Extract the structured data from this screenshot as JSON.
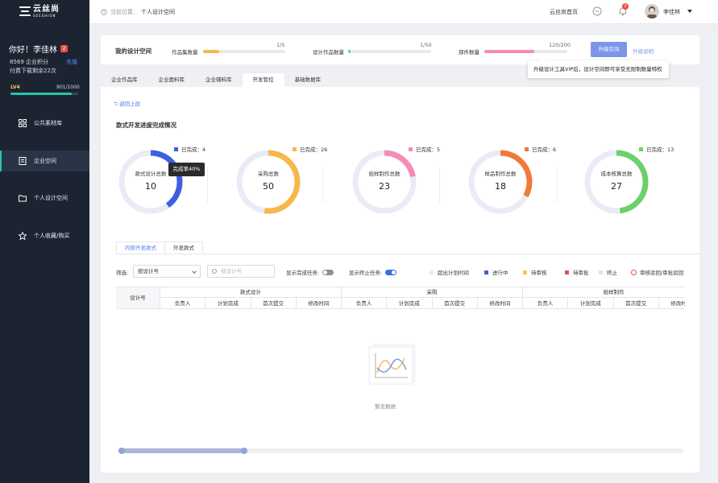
{
  "brand": {
    "name_cn": "云丝尚",
    "name_en": "SEESHION"
  },
  "sidebar": {
    "greeting": "你好！李佳林",
    "level_badge": "2",
    "points": "8569 企业积分",
    "recharge": "充值",
    "downloads_left": "付费下载剩余22次",
    "level": "LV4",
    "level_progress": "901/1000",
    "level_fraction": 0.9,
    "items": [
      {
        "label": "公共素材库",
        "icon": "grid-icon"
      },
      {
        "label": "企业空间",
        "icon": "doc-icon"
      },
      {
        "label": "个人设计空间",
        "icon": "folder-icon"
      },
      {
        "label": "个人收藏/购买",
        "icon": "star-icon"
      }
    ]
  },
  "topbar": {
    "crumb_prefix": "当前位置：",
    "crumb_current": "个人设计空间",
    "home_link": "云丝尚首页",
    "notify_count": "3",
    "user_name": "李佳林"
  },
  "quota": {
    "title": "我的设计空间",
    "items": [
      {
        "label": "作品集数量",
        "value": "1/5",
        "fraction": 0.2,
        "color": "#f7b84b"
      },
      {
        "label": "设计作品数量",
        "value": "1/50",
        "fraction": 0.02,
        "color": "#6cd06c"
      },
      {
        "label": "部件数量",
        "value": "120/200",
        "fraction": 0.6,
        "color": "#f48bb8"
      }
    ],
    "upgrade_button": "升级空间",
    "upgrade_info": "升级说明",
    "tooltip": "升级设计工具VIP后，设计空间即可享受无限制数量特权"
  },
  "tabs": [
    "企业作品库",
    "企业面料库",
    "企业辅料库",
    "开发管控",
    "基础数据库"
  ],
  "active_tab": 3,
  "main": {
    "back": "返回上层",
    "section_title": "款式开发进度完成情况",
    "donuts": [
      {
        "name": "款式设计总数",
        "total": "10",
        "done_label": "已完成：4",
        "fraction": 0.4,
        "color": "#3e5fe0"
      },
      {
        "name": "采购总数",
        "total": "50",
        "done_label": "已完成：26",
        "fraction": 0.52,
        "color": "#f7b84b"
      },
      {
        "name": "纸样制作总数",
        "total": "23",
        "done_label": "已完成：5",
        "fraction": 0.22,
        "color": "#f48bb8"
      },
      {
        "name": "样品制作总数",
        "total": "18",
        "done_label": "已完成：6",
        "fraction": 0.33,
        "color": "#f07a3a"
      },
      {
        "name": "成本核算总数",
        "total": "27",
        "done_label": "已完成：13",
        "fraction": 0.48,
        "color": "#6cd06c"
      }
    ],
    "donut_tooltip": "完成率40%",
    "subtabs": [
      "内部开发款式",
      "外发款式"
    ],
    "filter_label": "筛选:",
    "filter_select": "按设计号",
    "search_placeholder": "搜设计号",
    "show_done_label": "显示完成任务:",
    "show_stop_label": "显示终止任务:",
    "legend": [
      {
        "label": "超出计划时间",
        "color": "#e8ebf0"
      },
      {
        "label": "进行中",
        "color": "#3e5fe0"
      },
      {
        "label": "待审核",
        "color": "#f7c64a"
      },
      {
        "label": "待审批",
        "color": "#e84f4f"
      },
      {
        "label": "终止",
        "color": "#e0e3e8"
      },
      {
        "label": "审核驳回/审批驳回",
        "color": "#e84f4f"
      }
    ],
    "table": {
      "first_col": "设计号",
      "groups": [
        "款式设计",
        "采购",
        "纸样制作"
      ],
      "sub_cols": [
        "负责人",
        "计划完成",
        "首次提交",
        "修改时间"
      ]
    },
    "empty_text": "暂无数据"
  }
}
